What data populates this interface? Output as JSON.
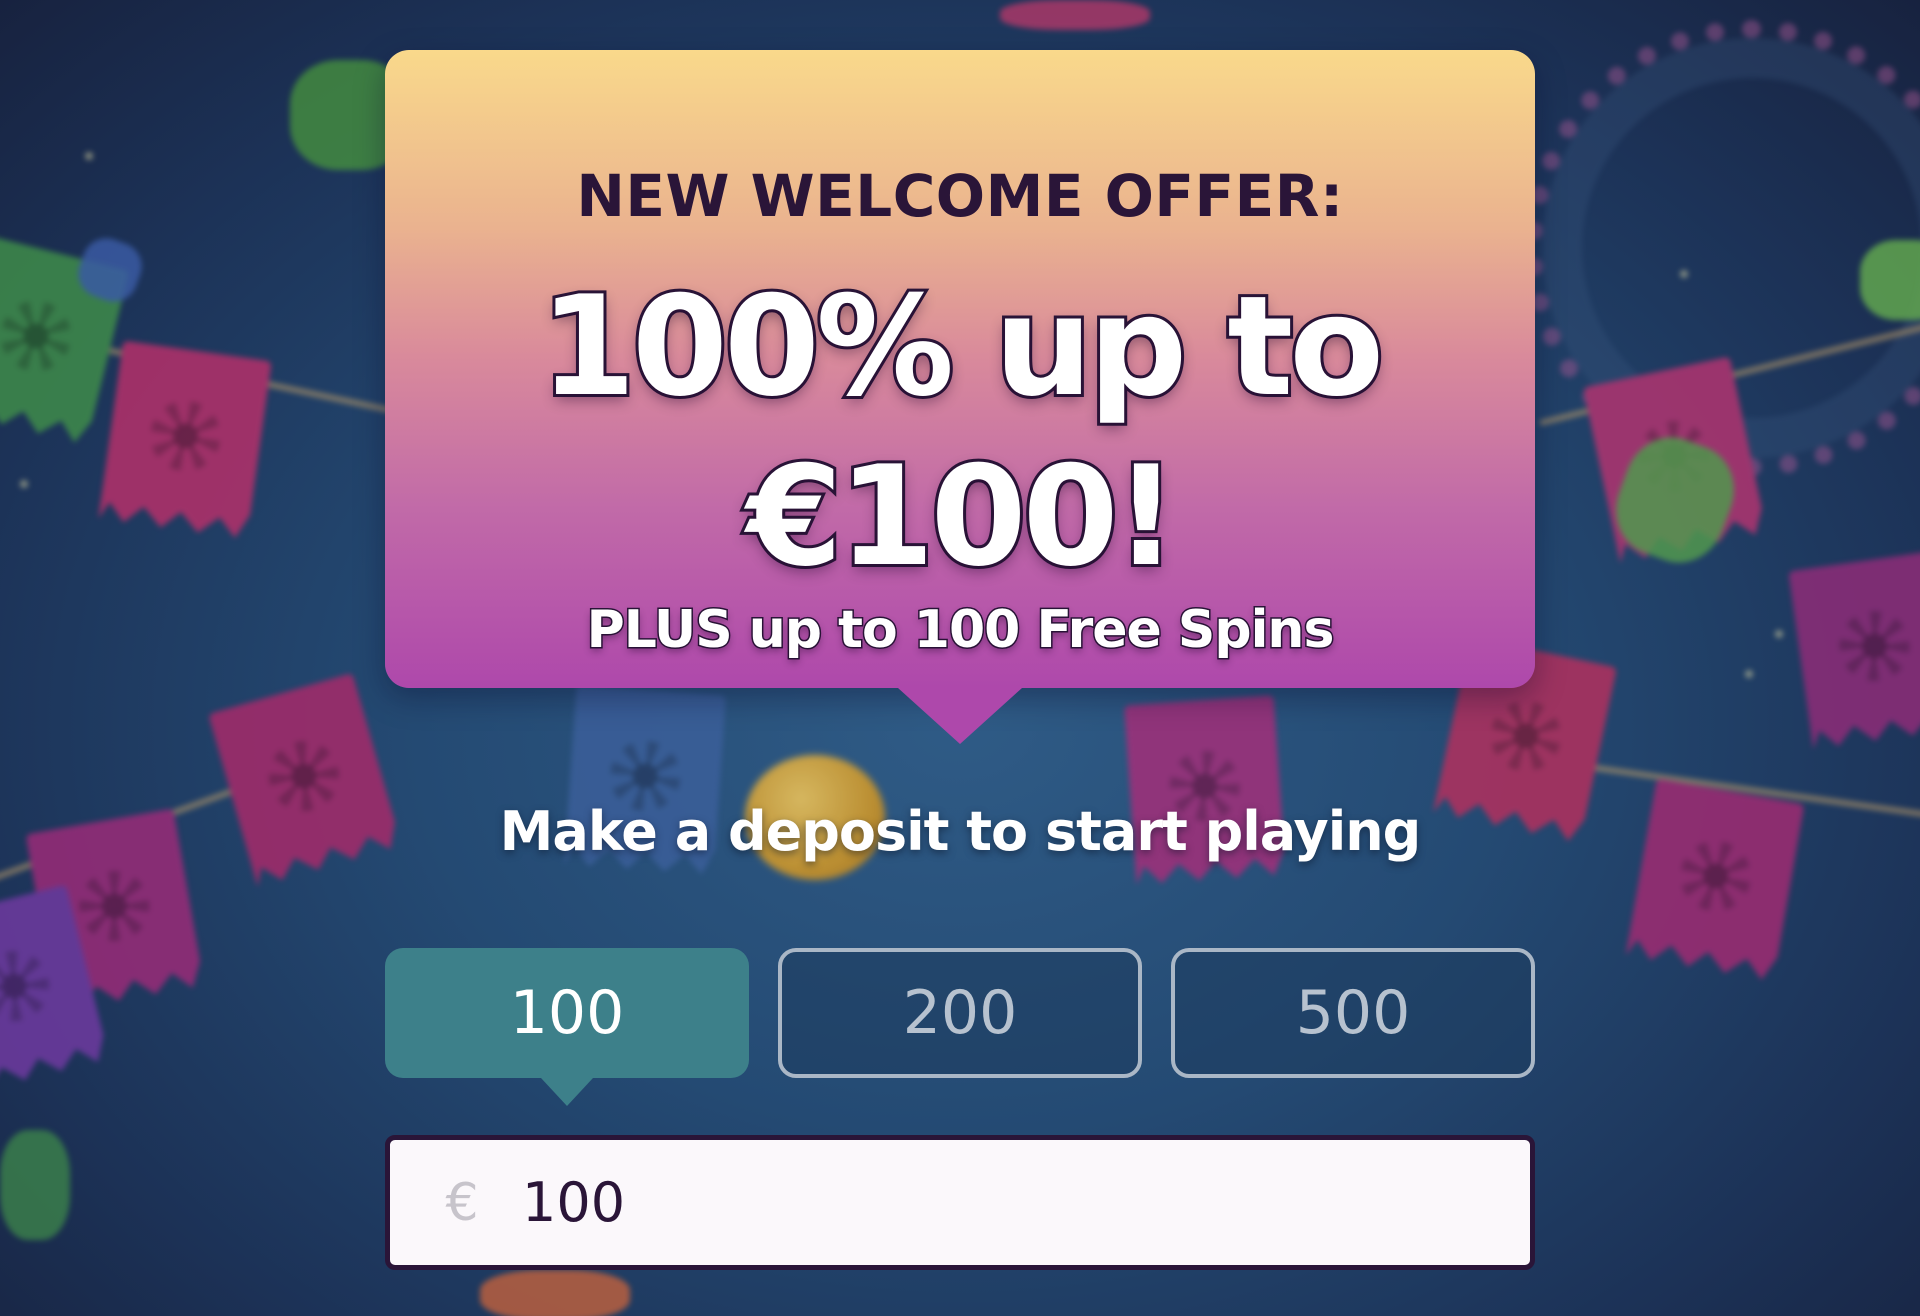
{
  "promo": {
    "kicker": "NEW WELCOME OFFER:",
    "headline_line1": "100% up to",
    "headline_line2": "€100!",
    "subline": "PLUS up to 100 Free Spins"
  },
  "deposit": {
    "prompt": "Make a deposit to start playing",
    "amount_options": [
      {
        "label": "100",
        "selected": true
      },
      {
        "label": "200",
        "selected": false
      },
      {
        "label": "500",
        "selected": false
      }
    ],
    "currency_symbol": "€",
    "amount_value": "100"
  },
  "colors": {
    "card_top": "#f9d98b",
    "card_bottom": "#ae48ab",
    "selected_button": "#3d808a",
    "text_dark": "#2a1538",
    "background": "#244a73"
  },
  "icons": {
    "currency": "euro-icon"
  }
}
